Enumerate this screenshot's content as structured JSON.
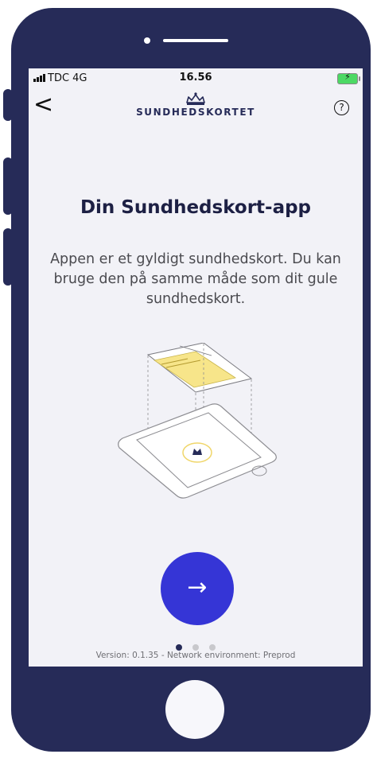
{
  "status_bar": {
    "carrier": "TDC  4G",
    "time": "16.56"
  },
  "nav": {
    "back_glyph": "<",
    "brand": "SUNDHEDSKORTET",
    "help_glyph": "?"
  },
  "main": {
    "title": "Din Sundhedskort-app",
    "description": "Appen er et gyldigt sundhedskort. Du kan bruge den på samme måde som dit gule sundhedskort."
  },
  "next_button": {
    "glyph": "→"
  },
  "pagination": {
    "current": 1,
    "total": 3
  },
  "footer": {
    "version": "Version: 0.1.35 - Network environment:  Preprod"
  },
  "colors": {
    "primary": "#3535d6",
    "navy": "#262b58",
    "card_yellow": "#f7e58a"
  },
  "icons": [
    "signal-icon",
    "battery-charging-icon",
    "back-chevron-icon",
    "crown-icon",
    "help-icon",
    "arrow-right-icon"
  ]
}
